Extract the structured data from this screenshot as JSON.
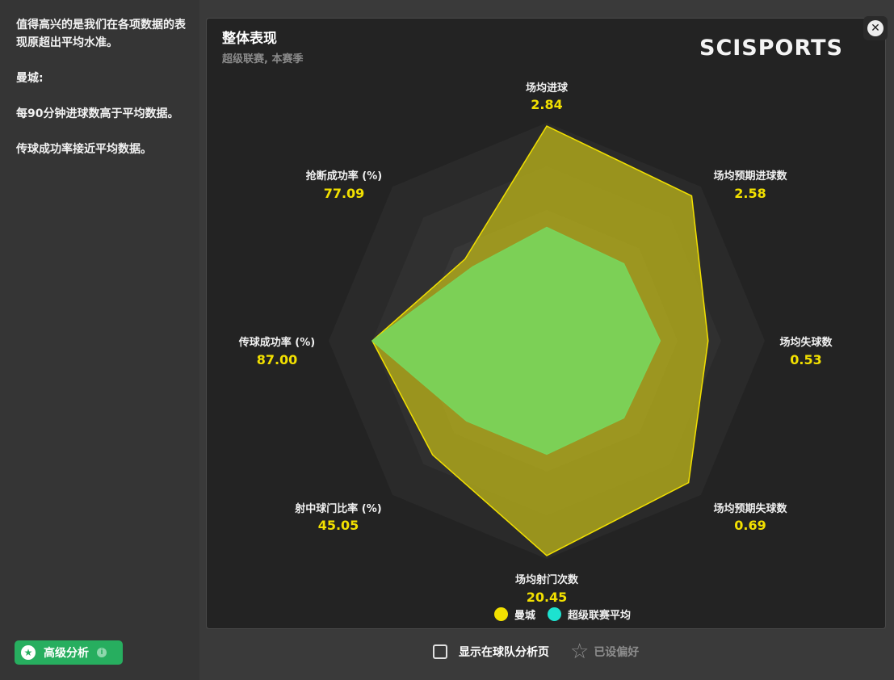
{
  "summary": {
    "lines": [
      "值得高兴的是我们在各项数据的表现原超出平均水准。",
      "曼城:",
      "每90分钟进球数高于平均数据。",
      "传球成功率接近平均数据。"
    ]
  },
  "advanced_button": {
    "label": "高级分析",
    "star_icon": "star-badge-icon",
    "info_icon": "info-icon"
  },
  "brand": "SCISPORTS",
  "close_icon": "close-icon",
  "footer": {
    "show_on_team_label": "显示在球队分析页",
    "favorite_label": "已设偏好",
    "favorite_icon": "star-outline-icon"
  },
  "colors": {
    "team": "#f2e000",
    "average": "#1de2d0",
    "team_fill": "#b9b11a",
    "average_fill": "#7ad35a"
  },
  "chart_data": {
    "type": "radar",
    "title": "整体表现",
    "subtitle": "超级联赛, 本赛季",
    "axes": [
      {
        "label": "场均进球",
        "value_label": "2.84"
      },
      {
        "label": "场均预期进球数",
        "value_label": "2.58"
      },
      {
        "label": "场均失球数",
        "value_label": "0.53"
      },
      {
        "label": "场均预期失球数",
        "value_label": "0.69"
      },
      {
        "label": "场均射门次数",
        "value_label": "20.45"
      },
      {
        "label": "射中球门比率 (%)",
        "value_label": "45.05"
      },
      {
        "label": "传球成功率 (%)",
        "value_label": "87.00"
      },
      {
        "label": "抢断成功率 (%)",
        "value_label": "77.09"
      }
    ],
    "scale_levels": 5,
    "series": [
      {
        "name": "曼城",
        "values": [
          0.985,
          0.94,
          0.74,
          0.92,
          0.985,
          0.74,
          0.8,
          0.53
        ]
      },
      {
        "name": "超级联赛平均",
        "values": [
          0.52,
          0.5,
          0.52,
          0.5,
          0.52,
          0.52,
          0.8,
          0.48
        ]
      }
    ]
  }
}
